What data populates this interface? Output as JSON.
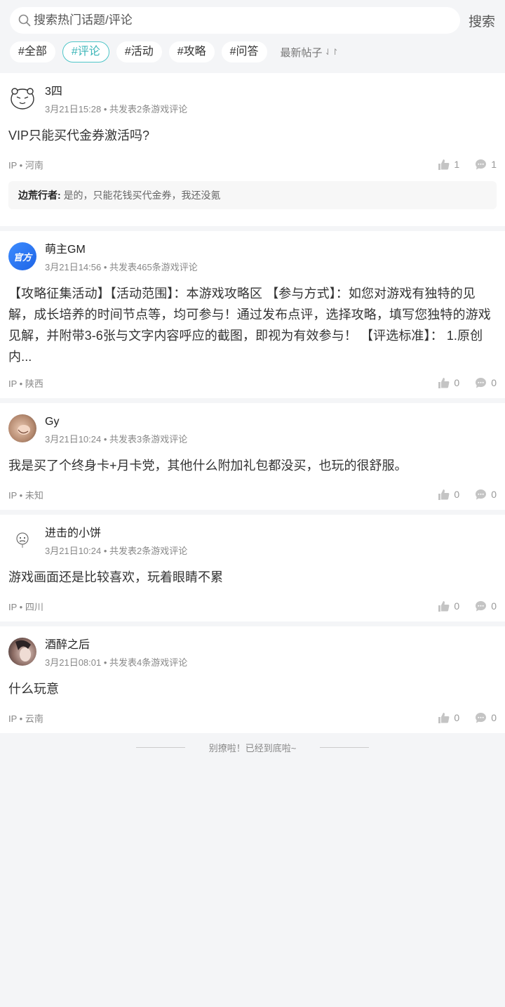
{
  "search": {
    "placeholder": "搜索热门话题/评论",
    "button": "搜索"
  },
  "tags": [
    "#全部",
    "#评论",
    "#活动",
    "#攻略",
    "#问答"
  ],
  "sort_label": "最新帖子",
  "posts": [
    {
      "name": "3四",
      "time": "3月21日15:28",
      "meta": "共发表2条游戏评论",
      "content": "VIP只能买代金券激活吗?",
      "ip": "IP • 河南",
      "likes": "1",
      "comments": "1",
      "reply": {
        "user": "边荒行者:",
        "text": "是的，只能花钱买代金券，我还没氪"
      }
    },
    {
      "name": "萌主GM",
      "time": "3月21日14:56",
      "meta": "共发表465条游戏评论",
      "avatar_text": "官方",
      "content": "【攻略征集活动】【活动范围】：本游戏攻略区 【参与方式】：如您对游戏有独特的见解，成长培养的时间节点等，均可参与！通过发布点评，选择攻略，填写您独特的游戏见解，并附带3-6张与文字内容呼应的截图，即视为有效参与！ 【评选标准】： 1.原创内...",
      "ip": "IP • 陕西",
      "likes": "0",
      "comments": "0"
    },
    {
      "name": "Gy",
      "time": "3月21日10:24",
      "meta": "共发表3条游戏评论",
      "content": "我是买了个终身卡+月卡党，其他什么附加礼包都没买，也玩的很舒服。",
      "ip": "IP • 未知",
      "likes": "0",
      "comments": "0"
    },
    {
      "name": "进击的小饼",
      "time": "3月21日10:24",
      "meta": "共发表2条游戏评论",
      "content": "游戏画面还是比较喜欢，玩着眼睛不累",
      "ip": "IP • 四川",
      "likes": "0",
      "comments": "0"
    },
    {
      "name": "酒醉之后",
      "time": "3月21日08:01",
      "meta": "共发表4条游戏评论",
      "content": "什么玩意",
      "ip": "IP • 云南",
      "likes": "0",
      "comments": "0"
    }
  ],
  "end_text": "别撩啦！已经到底啦~"
}
